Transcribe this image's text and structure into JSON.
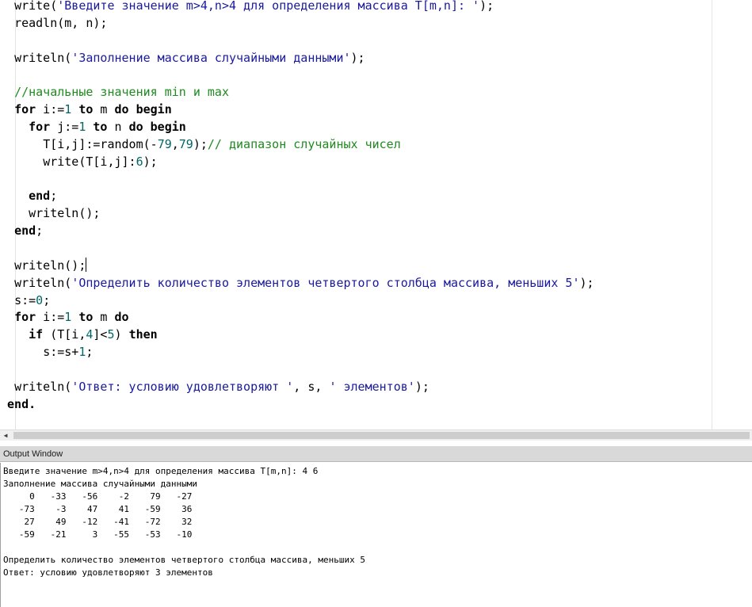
{
  "editor": {
    "lines": [
      [
        [
          "  ",
          "id"
        ],
        [
          "write(",
          "id"
        ],
        [
          "'Введите значение m>4,n>4 для определения массива T[m,n]: '",
          "str"
        ],
        [
          ");",
          "id"
        ]
      ],
      [
        [
          "  ",
          "id"
        ],
        [
          "readln(m, n);",
          "id"
        ]
      ],
      [
        [
          "",
          "id"
        ]
      ],
      [
        [
          "  ",
          "id"
        ],
        [
          "writeln(",
          "id"
        ],
        [
          "'Заполнение массива случайными данными'",
          "str"
        ],
        [
          ");",
          "id"
        ]
      ],
      [
        [
          "",
          "id"
        ]
      ],
      [
        [
          "  ",
          "id"
        ],
        [
          "//начальные значения min и max",
          "cmt"
        ]
      ],
      [
        [
          "  ",
          "id"
        ],
        [
          "for",
          "kw"
        ],
        [
          " i:=",
          "id"
        ],
        [
          "1",
          "num"
        ],
        [
          " ",
          "id"
        ],
        [
          "to",
          "kw"
        ],
        [
          " m ",
          "id"
        ],
        [
          "do",
          "kw"
        ],
        [
          " ",
          "id"
        ],
        [
          "begin",
          "kw"
        ]
      ],
      [
        [
          "    ",
          "id"
        ],
        [
          "for",
          "kw"
        ],
        [
          " j:=",
          "id"
        ],
        [
          "1",
          "num"
        ],
        [
          " ",
          "id"
        ],
        [
          "to",
          "kw"
        ],
        [
          " n ",
          "id"
        ],
        [
          "do",
          "kw"
        ],
        [
          " ",
          "id"
        ],
        [
          "begin",
          "kw"
        ]
      ],
      [
        [
          "      ",
          "id"
        ],
        [
          "T[i,j]:=random(-",
          "id"
        ],
        [
          "79",
          "num"
        ],
        [
          ",",
          "id"
        ],
        [
          "79",
          "num"
        ],
        [
          ");",
          "id"
        ],
        [
          "// диапазон случайных чисел",
          "cmt"
        ]
      ],
      [
        [
          "      ",
          "id"
        ],
        [
          "write(T[i,j]:",
          "id"
        ],
        [
          "6",
          "num"
        ],
        [
          ");",
          "id"
        ]
      ],
      [
        [
          "",
          "id"
        ]
      ],
      [
        [
          "    ",
          "id"
        ],
        [
          "end",
          "kw"
        ],
        [
          ";",
          "id"
        ]
      ],
      [
        [
          "    ",
          "id"
        ],
        [
          "writeln();",
          "id"
        ]
      ],
      [
        [
          "  ",
          "id"
        ],
        [
          "end",
          "kw"
        ],
        [
          ";",
          "id"
        ]
      ],
      [
        [
          "",
          "id"
        ]
      ],
      [
        [
          "  ",
          "id"
        ],
        [
          "writeln();",
          "id"
        ],
        [
          "|caret|",
          "caret"
        ]
      ],
      [
        [
          "  ",
          "id"
        ],
        [
          "writeln(",
          "id"
        ],
        [
          "'Определить количество элементов четвертого столбца массива, меньших 5'",
          "str"
        ],
        [
          ");",
          "id"
        ]
      ],
      [
        [
          "  ",
          "id"
        ],
        [
          "s:=",
          "id"
        ],
        [
          "0",
          "num"
        ],
        [
          ";",
          "id"
        ]
      ],
      [
        [
          "  ",
          "id"
        ],
        [
          "for",
          "kw"
        ],
        [
          " i:=",
          "id"
        ],
        [
          "1",
          "num"
        ],
        [
          " ",
          "id"
        ],
        [
          "to",
          "kw"
        ],
        [
          " m ",
          "id"
        ],
        [
          "do",
          "kw"
        ]
      ],
      [
        [
          "    ",
          "id"
        ],
        [
          "if",
          "kw"
        ],
        [
          " (T[i,",
          "id"
        ],
        [
          "4",
          "num"
        ],
        [
          "]<",
          "id"
        ],
        [
          "5",
          "num"
        ],
        [
          ") ",
          "id"
        ],
        [
          "then",
          "kw"
        ]
      ],
      [
        [
          "      ",
          "id"
        ],
        [
          "s:=s+",
          "id"
        ],
        [
          "1",
          "num"
        ],
        [
          ";",
          "id"
        ]
      ],
      [
        [
          "",
          "id"
        ]
      ],
      [
        [
          "  ",
          "id"
        ],
        [
          "writeln(",
          "id"
        ],
        [
          "'Ответ: условию удовлетворяют '",
          "str"
        ],
        [
          ", s, ",
          "id"
        ],
        [
          "' элементов'",
          "str"
        ],
        [
          ");",
          "id"
        ]
      ],
      [
        [
          " ",
          "id"
        ],
        [
          "end",
          "kw"
        ],
        [
          ".",
          "kw"
        ]
      ]
    ]
  },
  "output": {
    "title": "Output Window",
    "lines": [
      "Введите значение m>4,n>4 для определения массива T[m,n]: 4 6",
      "Заполнение массива случайными данными",
      "     0   -33   -56    -2    79   -27",
      "   -73    -3    47    41   -59    36",
      "    27    49   -12   -41   -72    32",
      "   -59   -21     3   -55   -53   -10",
      "",
      "Определить количество элементов четвертого столбца массива, меньших 5",
      "Ответ: условию удовлетворяют 3 элементов"
    ]
  },
  "scrollbar": {
    "left_arrow": "◀"
  }
}
